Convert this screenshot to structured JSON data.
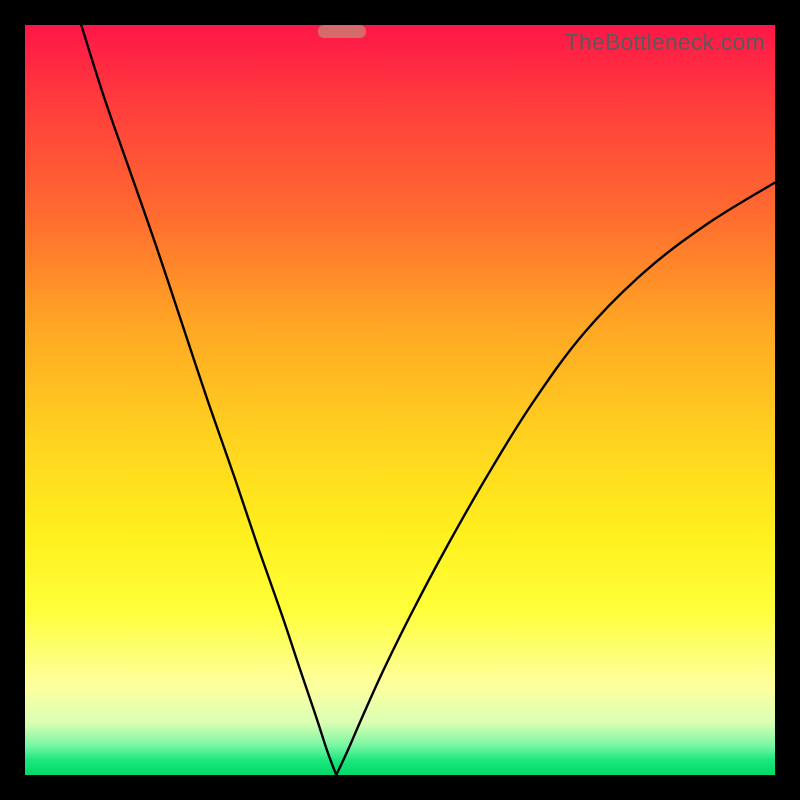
{
  "watermark": "TheBottleneck.com",
  "chart_data": {
    "type": "line",
    "title": "",
    "xlabel": "",
    "ylabel": "",
    "xlim": [
      0,
      1
    ],
    "ylim": [
      0,
      1
    ],
    "notch_x": 0.415,
    "marker": {
      "x_start": 0.39,
      "x_end": 0.455,
      "y": 0.992
    },
    "series": [
      {
        "name": "left-branch",
        "points": [
          {
            "x": 0.075,
            "y": 1.0
          },
          {
            "x": 0.105,
            "y": 0.905
          },
          {
            "x": 0.14,
            "y": 0.805
          },
          {
            "x": 0.175,
            "y": 0.705
          },
          {
            "x": 0.21,
            "y": 0.6
          },
          {
            "x": 0.245,
            "y": 0.495
          },
          {
            "x": 0.28,
            "y": 0.395
          },
          {
            "x": 0.312,
            "y": 0.3
          },
          {
            "x": 0.342,
            "y": 0.215
          },
          {
            "x": 0.367,
            "y": 0.14
          },
          {
            "x": 0.388,
            "y": 0.078
          },
          {
            "x": 0.403,
            "y": 0.032
          },
          {
            "x": 0.415,
            "y": 0.0
          }
        ]
      },
      {
        "name": "right-branch",
        "points": [
          {
            "x": 0.415,
            "y": 0.0
          },
          {
            "x": 0.43,
            "y": 0.032
          },
          {
            "x": 0.45,
            "y": 0.078
          },
          {
            "x": 0.478,
            "y": 0.14
          },
          {
            "x": 0.515,
            "y": 0.215
          },
          {
            "x": 0.56,
            "y": 0.3
          },
          {
            "x": 0.614,
            "y": 0.395
          },
          {
            "x": 0.676,
            "y": 0.495
          },
          {
            "x": 0.746,
            "y": 0.59
          },
          {
            "x": 0.825,
            "y": 0.67
          },
          {
            "x": 0.91,
            "y": 0.735
          },
          {
            "x": 1.0,
            "y": 0.79
          }
        ]
      }
    ]
  }
}
